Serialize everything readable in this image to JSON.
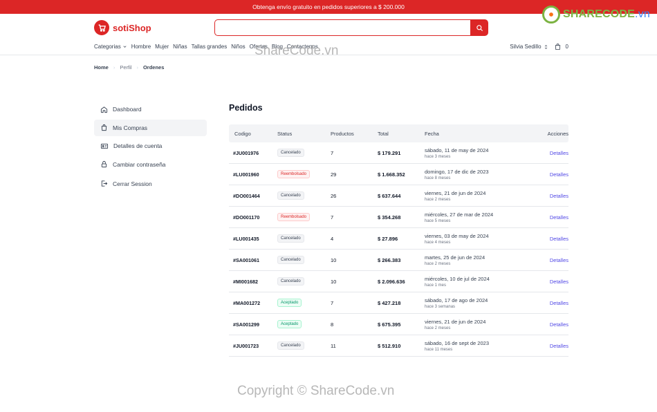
{
  "promo": "Obtenga envío gratuito en pedidos superiores a $ 200.000",
  "brand": {
    "name": "sotiShop",
    "color": "#dc2626"
  },
  "search": {
    "placeholder": "",
    "icon": "search-icon"
  },
  "corner_logo": {
    "text_a": "SHARECODE",
    "text_b": ".vn"
  },
  "nav": {
    "categories": "Categorias",
    "items": [
      "Hombre",
      "Mujer",
      "Niñas",
      "Tallas grandes",
      "Niños",
      "Ofertas",
      "Blog",
      "Contactenos"
    ]
  },
  "user": {
    "name": "Silvia Sedillo",
    "cart_count": "0"
  },
  "breadcrumb": [
    "Home",
    "Perfil",
    "Ordenes"
  ],
  "sidebar": [
    {
      "label": "Dashboard",
      "icon": "home-icon"
    },
    {
      "label": "Mis Compras",
      "icon": "shopping-bag-icon"
    },
    {
      "label": "Detalles de cuenta",
      "icon": "id-card-icon"
    },
    {
      "label": "Cambiar contraseña",
      "icon": "lock-icon"
    },
    {
      "label": "Cerrar Session",
      "icon": "logout-icon"
    }
  ],
  "page_title": "Pedidos",
  "table": {
    "headers": [
      "Codigo",
      "Status",
      "Productos",
      "Total",
      "Fecha",
      "Acciones"
    ],
    "rows": [
      {
        "code": "#JU001976",
        "status": "Cancelado",
        "products": "7",
        "total": "$ 179.291",
        "date": "sábado, 11 de may de 2024",
        "ago": "hace 3 meses",
        "action": "Detalles"
      },
      {
        "code": "#LU001960",
        "status": "Reembolsado",
        "products": "29",
        "total": "$ 1.668.352",
        "date": "domingo, 17 de dic de 2023",
        "ago": "hace 8 meses",
        "action": "Detalles"
      },
      {
        "code": "#DO001464",
        "status": "Cancelado",
        "products": "26",
        "total": "$ 637.644",
        "date": "viernes, 21 de jun de 2024",
        "ago": "hace 2 meses",
        "action": "Detalles"
      },
      {
        "code": "#DO001170",
        "status": "Reembolsado",
        "products": "7",
        "total": "$ 354.268",
        "date": "miércoles, 27 de mar de 2024",
        "ago": "hace 5 meses",
        "action": "Detalles"
      },
      {
        "code": "#LU001435",
        "status": "Cancelado",
        "products": "4",
        "total": "$ 27.896",
        "date": "viernes, 03 de may de 2024",
        "ago": "hace 4 meses",
        "action": "Detalles"
      },
      {
        "code": "#SA001061",
        "status": "Cancelado",
        "products": "10",
        "total": "$ 266.383",
        "date": "martes, 25 de jun de 2024",
        "ago": "hace 2 meses",
        "action": "Detalles"
      },
      {
        "code": "#MI001682",
        "status": "Cancelado",
        "products": "10",
        "total": "$ 2.096.636",
        "date": "miércoles, 10 de jul de 2024",
        "ago": "hace 1 mes",
        "action": "Detalles"
      },
      {
        "code": "#MA001272",
        "status": "Aceptado",
        "products": "7",
        "total": "$ 427.218",
        "date": "sábado, 17 de ago de 2024",
        "ago": "hace 3 semanas",
        "action": "Detalles"
      },
      {
        "code": "#SA001299",
        "status": "Aceptado",
        "products": "8",
        "total": "$ 675.395",
        "date": "viernes, 21 de jun de 2024",
        "ago": "hace 2 meses",
        "action": "Detalles"
      },
      {
        "code": "#JU001723",
        "status": "Cancelado",
        "products": "11",
        "total": "$ 512.910",
        "date": "sábado, 16 de sept de 2023",
        "ago": "hace 11 meses",
        "action": "Detalles"
      }
    ]
  },
  "watermarks": [
    "ShareCode.vn",
    "Copyright © ShareCode.vn"
  ]
}
